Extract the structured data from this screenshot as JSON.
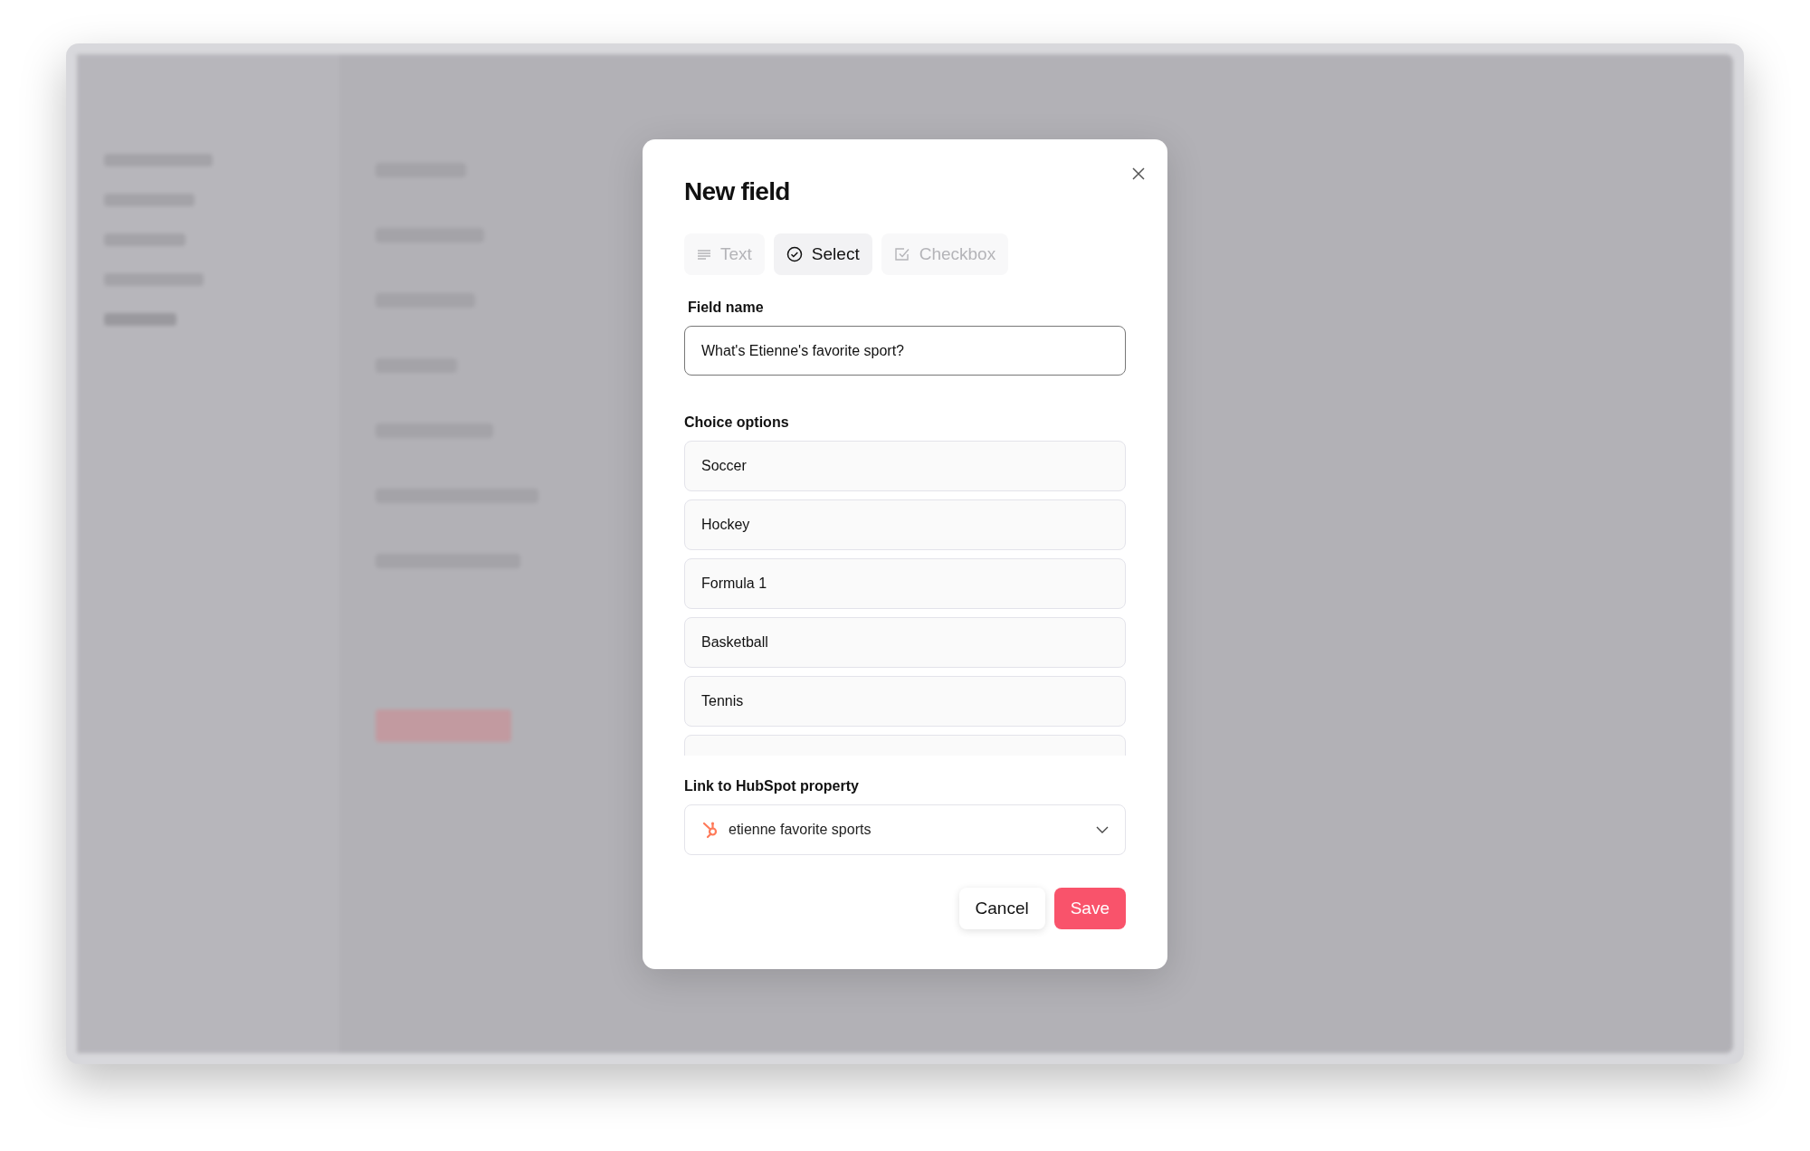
{
  "dialog": {
    "title": "New field",
    "tabs": [
      {
        "label": "Text",
        "kind": "text",
        "selected": false
      },
      {
        "label": "Select",
        "kind": "select",
        "selected": true
      },
      {
        "label": "Checkbox",
        "kind": "checkbox",
        "selected": false
      }
    ],
    "field_name": {
      "label": "Field name",
      "value": "What's Etienne's favorite sport?"
    },
    "choice_options": {
      "label": "Choice options",
      "options": [
        "Soccer",
        "Hockey",
        "Formula 1",
        "Basketball",
        "Tennis"
      ]
    },
    "hubspot_property": {
      "label": "Link to HubSpot property",
      "value": "etienne favorite sports"
    },
    "buttons": [
      {
        "label": "Cancel",
        "kind": "secondary"
      },
      {
        "label": "Save",
        "kind": "primary"
      }
    ]
  }
}
